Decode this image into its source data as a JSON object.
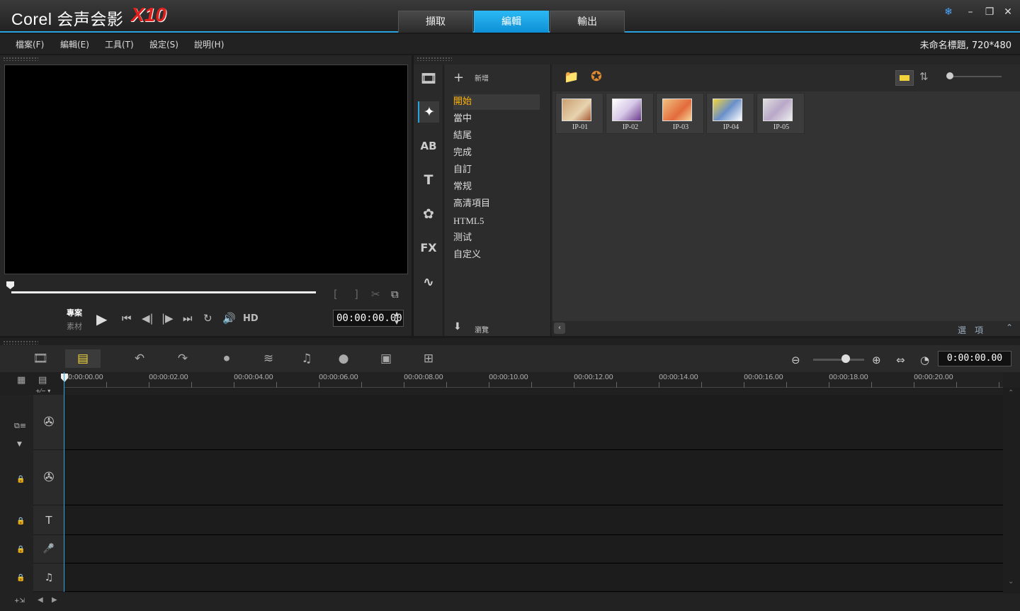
{
  "app": {
    "title": "Corel 会声会影",
    "version": "X10"
  },
  "main_tabs": [
    {
      "label": "擷取"
    },
    {
      "label": "編輯"
    },
    {
      "label": "輸出"
    }
  ],
  "menu": [
    {
      "label": "檔案(F)"
    },
    {
      "label": "編輯(E)"
    },
    {
      "label": "工具(T)"
    },
    {
      "label": "設定(S)"
    },
    {
      "label": "說明(H)"
    }
  ],
  "project_info": "未命名標題, 720*480",
  "player": {
    "mode_project": "專案",
    "mode_clip": "素材",
    "hd": "HD",
    "timecode": "00:00:00.00"
  },
  "library": {
    "add_label": "新增",
    "categories": [
      {
        "label": "開始"
      },
      {
        "label": "當中"
      },
      {
        "label": "結尾"
      },
      {
        "label": "完成"
      },
      {
        "label": "自訂"
      },
      {
        "label": "常规"
      },
      {
        "label": "高清項目"
      },
      {
        "label": "HTML5"
      },
      {
        "label": "测试"
      },
      {
        "label": "自定义"
      }
    ],
    "browse_label": "瀏覽",
    "options_label": "選　項",
    "thumbnails": [
      {
        "label": "IP-01"
      },
      {
        "label": "IP-02"
      },
      {
        "label": "IP-03"
      },
      {
        "label": "IP-04"
      },
      {
        "label": "IP-05"
      }
    ]
  },
  "timeline": {
    "timecode": "0:00:00.00",
    "ruler": [
      "00:00:00.00",
      "00:00:02.00",
      "00:00:04.00",
      "00:00:06.00",
      "00:00:08.00",
      "00:00:10.00",
      "00:00:12.00",
      "00:00:14.00",
      "00:00:16.00",
      "00:00:18.00",
      "00:00:20.00"
    ]
  },
  "colors": {
    "accent": "#29a3e0",
    "active_category": "#ffb000",
    "brand_red": "#e0201c"
  }
}
